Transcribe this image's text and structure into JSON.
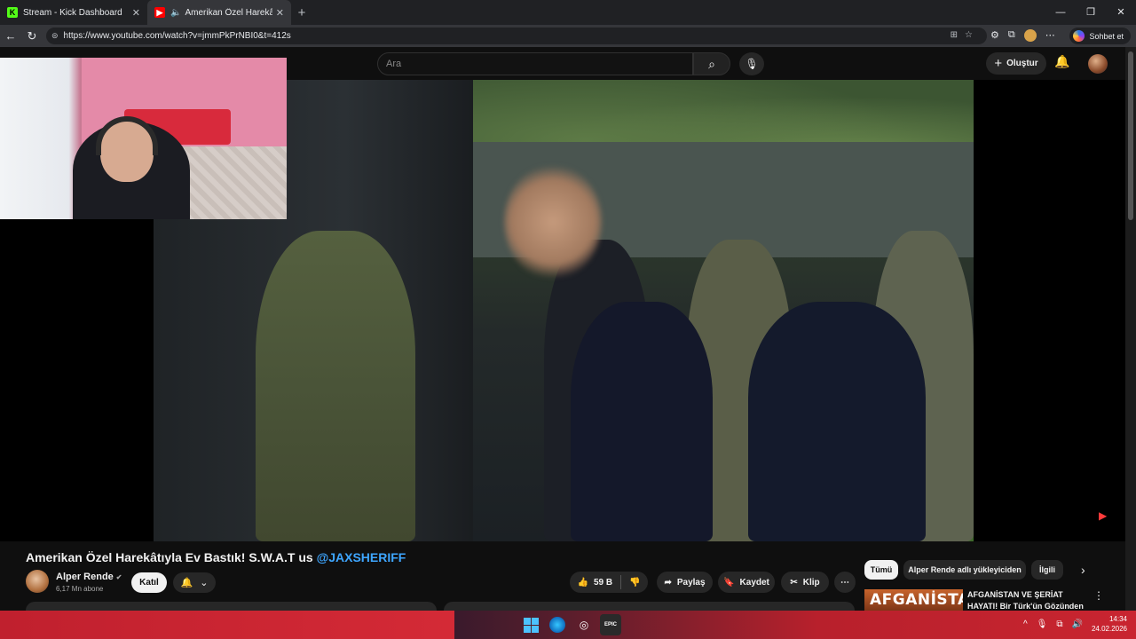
{
  "browser": {
    "tabs": [
      {
        "label": "Stream - Kick Dashboard",
        "favicon": "kick-icon"
      },
      {
        "label": "Amerikan Özel Harekâtıyla Ev Bastık! S.W.A.T us @JAXSHERIFF",
        "favicon": "youtube-icon",
        "audio": true,
        "active": true
      }
    ],
    "url": "https://www.youtube.com/watch?v=jmmPkPrNBI0&t=412s",
    "chat_button": "Sohbet et"
  },
  "youtube": {
    "search_placeholder": "Ara",
    "create_label": "Oluştur",
    "video": {
      "title_main": "Amerikan Özel Harekâtıyla Ev Bastık! S.W.A.T us ",
      "title_tag": "@JAXSHERIFF",
      "channel_name": "Alper Rende",
      "subscribers": "6,17 Mn abone",
      "join_label": "Katıl",
      "likes": "59 B",
      "share_label": "Paylaş",
      "save_label": "Kaydet",
      "clip_label": "Klip"
    },
    "chips": [
      "Tümü",
      "Alper Rende adlı yükleyiciden",
      "İlgili"
    ],
    "recommendation": {
      "thumb_text": "AFGANİSTAN",
      "title": "AFGANİSTAN VE ŞERİAT HAYATI! Bir Türk'ün Gözünden"
    }
  },
  "taskbar": {
    "time": "14:34",
    "date": "24.02.2026"
  }
}
